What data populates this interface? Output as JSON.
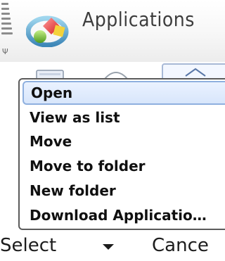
{
  "header": {
    "title": "Applications",
    "logo_icon": "applications-folder-icon",
    "signal_icon": "signal-strength-icon",
    "antenna_icon": "antenna-icon"
  },
  "menu": {
    "items": [
      {
        "label": "Open",
        "selected": true
      },
      {
        "label": "View as list",
        "selected": false
      },
      {
        "label": "Move",
        "selected": false
      },
      {
        "label": "Move to folder",
        "selected": false
      },
      {
        "label": "New folder",
        "selected": false
      },
      {
        "label": "Download Applicatio…",
        "selected": false
      }
    ]
  },
  "softkeys": {
    "left": "Select",
    "right": "Cance",
    "center_icon": "down-arrow-icon"
  },
  "colors": {
    "menu_border": "#5b5b5b",
    "selection_fill": "#d8e6fb",
    "selection_border": "#8fb0df",
    "title_text": "#3d3d3d"
  }
}
